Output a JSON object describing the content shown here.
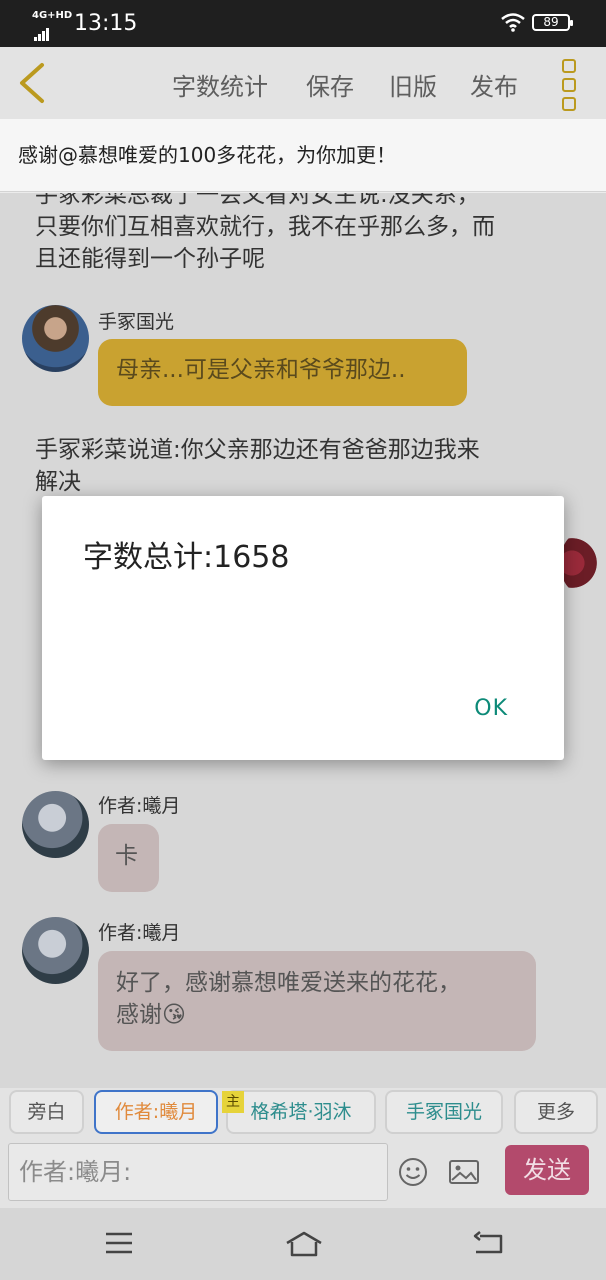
{
  "status_bar": {
    "network": "4G+HD",
    "time": "13:15",
    "battery": "89"
  },
  "toolbar": {
    "back_icon": "chevron-left-icon",
    "items": [
      "字数统计",
      "保存",
      "旧版",
      "发布"
    ],
    "more_icon": "vertical-dots-icon"
  },
  "notice": "感谢@慕想唯爱的100多花花，为你加更！",
  "chat": {
    "narration_1": {
      "line1": "手冢彩菜总裁了一会又看对女主说:没关系，",
      "line2": "只要你们互相喜欢就行，我不在乎那么多，而",
      "line3": "且还能得到一个孙子呢"
    },
    "msg_1": {
      "speaker": "手冢国光",
      "text": "母亲...可是父亲和爷爷那边.."
    },
    "narration_2": {
      "line1": "手冢彩菜说道:你父亲那边还有爸爸那边我来",
      "line2": "解决"
    },
    "msg_2": {
      "speaker": "作者:曦月",
      "text": "卡"
    },
    "msg_3": {
      "speaker": "作者:曦月",
      "line1": "好了，感谢慕想唯爱送来的花花，",
      "line2": "感谢😘"
    }
  },
  "dialog": {
    "message": "字数总计:1658",
    "ok_label": "OK"
  },
  "chips": {
    "narrator": "旁白",
    "author": "作者:曦月",
    "main_badge": "主",
    "char1": "格希塔·羽沐",
    "char2": "手冢国光",
    "more": "更多"
  },
  "input": {
    "placeholder": "作者:曦月:",
    "send_label": "发送"
  },
  "colors": {
    "accent_gold": "#c9a230",
    "teal": "#0d8a78",
    "send": "#b34a6c",
    "author_chip_border": "#3f74c9"
  }
}
